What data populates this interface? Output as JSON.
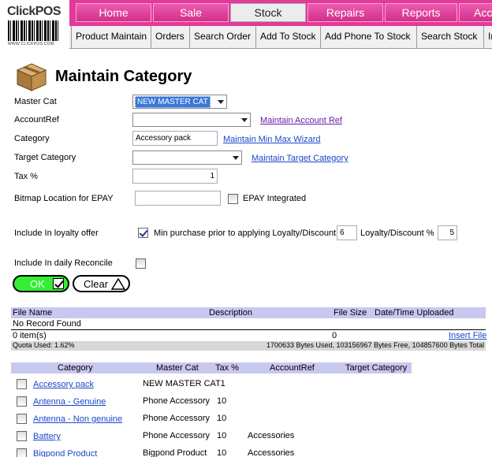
{
  "app": {
    "logo_text_click": "Click",
    "logo_text_pos": "POS",
    "logo_caption": "WWW.CLICKPOS.COM"
  },
  "nav": {
    "top_tabs": [
      {
        "label": "Home"
      },
      {
        "label": "Sale"
      },
      {
        "label": "Stock"
      },
      {
        "label": "Repairs"
      },
      {
        "label": "Reports"
      },
      {
        "label": "Acc"
      }
    ],
    "active_top_tab": "Stock",
    "sub_tabs": [
      {
        "label": "Product Maintain"
      },
      {
        "label": "Orders"
      },
      {
        "label": "Search Order"
      },
      {
        "label": "Add To Stock"
      },
      {
        "label": "Add Phone To Stock"
      },
      {
        "label": "Search Stock"
      },
      {
        "label": "In"
      }
    ]
  },
  "page": {
    "title": "Maintain Category"
  },
  "form": {
    "master_cat_label": "Master Cat",
    "master_cat_value": "NEW MASTER CAT",
    "account_ref_label": "AccountRef",
    "account_ref_value": "",
    "maintain_account_ref_link": "Maintain Account Ref",
    "category_label": "Category",
    "category_value": "Accessory pack",
    "maintain_min_max_link": "Maintain Min Max Wizard",
    "target_category_label": "Target Category",
    "target_category_value": "",
    "maintain_target_category_link": "Maintain Target Category",
    "tax_label": "Tax %",
    "tax_value": "1",
    "bitmap_label": "Bitmap Location for EPAY",
    "bitmap_value": "",
    "epay_integrated_label": "EPAY Integrated",
    "epay_integrated_checked": false,
    "loyalty_label": "Include In loyalty offer",
    "loyalty_checked": true,
    "min_purchase_label": "Min purchase prior to applying Loyalty/Discount",
    "min_purchase_value": "6",
    "loyalty_discount_label": "Loyalty/Discount %",
    "loyalty_discount_value": "5",
    "daily_reconcile_label": "Include In daily Reconcile",
    "daily_reconcile_checked": false,
    "ok_label": "OK",
    "clear_label": "Clear"
  },
  "files": {
    "columns": [
      "File Name",
      "Description",
      "File Size",
      "Date/Time Uploaded"
    ],
    "no_record_text": "No Record Found",
    "items_text": "0 item(s)",
    "count_text": "0",
    "insert_file_link": "Insert File",
    "quota_used_text": "Quota Used: 1.62%",
    "quota_detail_text": "1700633 Bytes Used, 103156967 Bytes Free, 104857600 Bytes Total"
  },
  "categories": {
    "columns": [
      "Category",
      "Master Cat",
      "Tax %",
      "AccountRef",
      "Target Category"
    ],
    "rows": [
      {
        "category": "Accessory pack",
        "master_cat": "NEW MASTER CAT",
        "tax": "1",
        "account_ref": "",
        "target_category": ""
      },
      {
        "category": "Antenna - Genuine",
        "master_cat": "Phone Accessory",
        "tax": "10",
        "account_ref": "",
        "target_category": ""
      },
      {
        "category": "Antenna - Non genuine",
        "master_cat": "Phone Accessory",
        "tax": "10",
        "account_ref": "",
        "target_category": ""
      },
      {
        "category": "Battery",
        "master_cat": "Phone Accessory",
        "tax": "10",
        "account_ref": "Accessories",
        "target_category": ""
      },
      {
        "category": "Bigpond Product",
        "master_cat": "Bigpond Product",
        "tax": "10",
        "account_ref": "Accessories",
        "target_category": ""
      }
    ]
  },
  "colors": {
    "nav_pink": "#e23a9a",
    "header_lavender": "#c9c8f0",
    "ok_green": "#33ee33",
    "link_blue": "#1a47c8"
  }
}
